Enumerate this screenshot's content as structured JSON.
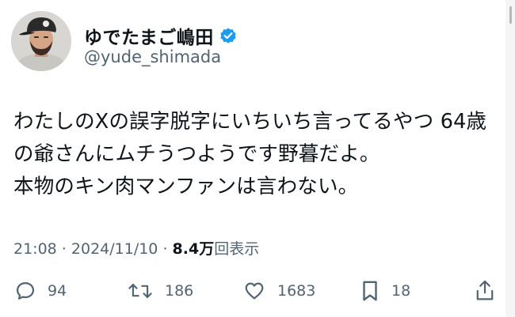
{
  "author": {
    "display_name": "ゆでたまご嶋田",
    "handle": "@yude_shimada",
    "verified": true,
    "verified_color": "#1d9bf0"
  },
  "tweet": {
    "text": "わたしのXの誤字脱字にいちいち言ってるやつ 64歳\nの爺さんにムチうつようです野暮だよ。\n本物のキン肉マンファンは言わない。"
  },
  "meta": {
    "time": "21:08",
    "separator": " · ",
    "date": "2024/11/10",
    "separator2": " · ",
    "views_value": "8.4",
    "views_unit": "万",
    "views_label": "回表示"
  },
  "actions": {
    "reply": {
      "icon": "reply-icon",
      "count": "94"
    },
    "retweet": {
      "icon": "retweet-icon",
      "count": "186"
    },
    "like": {
      "icon": "heart-icon",
      "count": "1683"
    },
    "bookmark": {
      "icon": "bookmark-icon",
      "count": "18"
    },
    "share": {
      "icon": "share-icon"
    }
  },
  "colors": {
    "text": "#0f1419",
    "secondary": "#536471",
    "accent": "#1d9bf0"
  }
}
